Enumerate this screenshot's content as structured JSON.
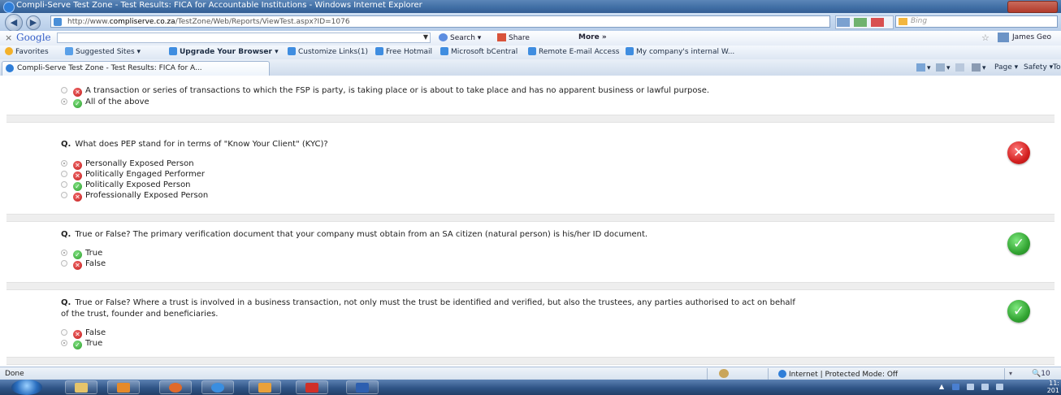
{
  "window": {
    "title": "Compli-Serve Test Zone - Test Results: FICA for Accountable Institutions - Windows Internet Explorer"
  },
  "addressbar": {
    "url_prefix": "http://www.",
    "url_domain": "compliserve.co.za",
    "url_path": "/TestZone/Web/Reports/ViewTest.aspx?ID=1076",
    "search_placeholder": "Bing"
  },
  "google_toolbar": {
    "logo": "Google",
    "search_label": "Search",
    "share_label": "Share",
    "more_label": "More »",
    "user": "James Geo"
  },
  "favorites": {
    "label": "Favorites",
    "items": [
      "Suggested Sites ▾",
      "Upgrade Your Browser ▾",
      "Customize Links(1)",
      "Free Hotmail",
      "Microsoft bCentral",
      "Remote E-mail Access",
      "My company's internal W..."
    ]
  },
  "tabbar": {
    "tab_title": "Compli-Serve Test Zone - Test Results: FICA for A...",
    "page_label": "Page ▾",
    "safety_label": "Safety ▾",
    "tools_label": "Tool"
  },
  "content": {
    "prev_options": [
      {
        "text": "A transaction or series of transactions to which the FSP is party, is taking place or is about to take place and has no apparent business or lawful purpose.",
        "mark": "wrong",
        "selected": false
      },
      {
        "text": "All of the above",
        "mark": "right",
        "selected": true
      }
    ],
    "questions": [
      {
        "prefix": "Q.",
        "text": "What does PEP stand for in terms of \"Know Your Client\" (KYC)?",
        "text2": "",
        "result": "wrong",
        "options": [
          {
            "text": "Personally Exposed Person",
            "mark": "wrong",
            "selected": true
          },
          {
            "text": "Politically Engaged Performer",
            "mark": "wrong",
            "selected": false
          },
          {
            "text": "Politically Exposed Person",
            "mark": "right",
            "selected": false
          },
          {
            "text": "Professionally Exposed Person",
            "mark": "wrong",
            "selected": false
          }
        ]
      },
      {
        "prefix": "Q.",
        "text": "True or False? The primary verification document that your company must obtain from an SA citizen (natural person) is his/her ID document.",
        "text2": "",
        "result": "right",
        "options": [
          {
            "text": "True",
            "mark": "right",
            "selected": true
          },
          {
            "text": "False",
            "mark": "wrong",
            "selected": false
          }
        ]
      },
      {
        "prefix": "Q.",
        "text": "True or False? Where a trust is involved in a business transaction, not only must the trust be identified and verified, but also the trustees, any parties authorised to act on behalf",
        "text2": "of the trust, founder and beneficiaries.",
        "result": "right",
        "options": [
          {
            "text": "False",
            "mark": "wrong",
            "selected": false
          },
          {
            "text": "True",
            "mark": "right",
            "selected": true
          }
        ]
      }
    ]
  },
  "statusbar": {
    "status": "Done",
    "zone": "Internet | Protected Mode: Off",
    "zoom": "10"
  },
  "taskbar": {
    "clock_line1": "11:",
    "clock_line2": "201"
  },
  "colors": {
    "wrong": "#d32020",
    "right": "#32a432"
  }
}
